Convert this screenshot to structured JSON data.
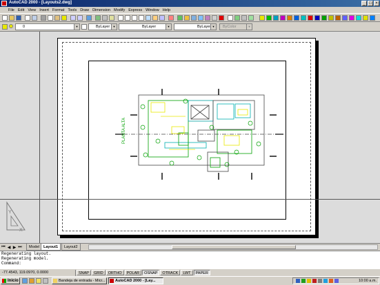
{
  "window": {
    "title": "AutoCAD 2000 - [Layouts2.dwg]",
    "controls": [
      "_",
      "□",
      "×"
    ]
  },
  "menu": [
    "File",
    "Edit",
    "View",
    "Insert",
    "Format",
    "Tools",
    "Draw",
    "Dimension",
    "Modify",
    "Express",
    "Window",
    "Help"
  ],
  "properties": {
    "layer": "0",
    "color": "ByLayer",
    "linetype": "ByLayer",
    "lineweight": "ByLayer",
    "plotstyle": "ByColor"
  },
  "drawing": {
    "label": "PLANTA ALTA",
    "accent_yellow": "#e8e800",
    "accent_green": "#00a000",
    "accent_cyan": "#00b0b0"
  },
  "layout_tabs": [
    "Model",
    "Layout1",
    "Layout2"
  ],
  "active_tab": "Layout1",
  "command_lines": [
    "Regenerating layout.",
    "Regenerating model.",
    "Command:"
  ],
  "status": {
    "coordinates": "-77.4543, 119.0970, 0.0000",
    "toggles": [
      "SNAP",
      "GRID",
      "ORTHO",
      "POLAR",
      "OSNAP",
      "OTRACK",
      "LWT",
      "PAPER"
    ],
    "active_toggles": [
      "OSNAP",
      "PAPER"
    ]
  },
  "taskbar": {
    "start_label": "Inicio",
    "tasks": [
      "Bandeja de entrada - Micr...",
      "AutoCAD 2000 - [Lay..."
    ],
    "clock": "10:00 a.m."
  }
}
